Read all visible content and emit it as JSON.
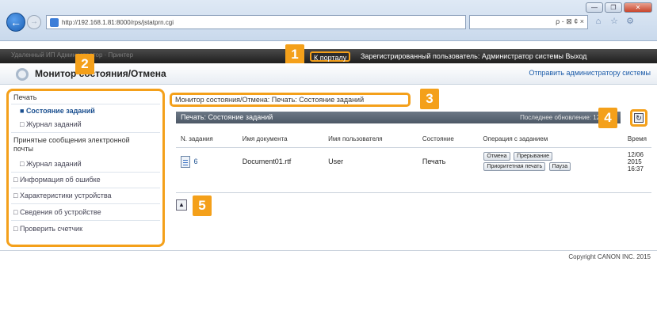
{
  "browser": {
    "address_url": "http://192.168.1.81:8000/rps/jstatprn.cgi",
    "search_text": "ρ - ⊠ ¢ ×",
    "window_buttons": [
      "—",
      "❐",
      "✕"
    ],
    "icons": [
      "home-icon",
      "star-icon",
      "gear-icon"
    ]
  },
  "topbar": {
    "left_text": "Удаленный ИП Администратор · Принтер",
    "portal_link": "К порталу",
    "user_text": "Зарегистрированный пользователь: Администратор системы Выход"
  },
  "header": {
    "title": "Монитор состояния/Отмена",
    "admin_link": "Отправить администратору системы"
  },
  "sidebar": {
    "items": [
      {
        "label": "Печать",
        "type": "section"
      },
      {
        "label": "Состояние заданий",
        "type": "active"
      },
      {
        "label": "Журнал заданий",
        "type": "sub"
      },
      {
        "label": "Принятые сообщения электронной",
        "type": "section"
      },
      {
        "label": "почты",
        "type": "section-cont"
      },
      {
        "label": "Журнал заданий",
        "type": "sub"
      },
      {
        "label": "Информация об ошибке",
        "type": "link"
      },
      {
        "label": "Характеристики устройства",
        "type": "link"
      },
      {
        "label": "Сведения об устройстве",
        "type": "link"
      },
      {
        "label": "Проверить счетчик",
        "type": "link"
      }
    ]
  },
  "breadcrumb": "Монитор состояния/Отмена: Печать: Состояние заданий",
  "panel": {
    "title": "Печать: Состояние заданий",
    "last_updated": "Последнее обновление: 12/06 2"
  },
  "table": {
    "headers": [
      "N. задания",
      "Имя документа",
      "Имя пользователя",
      "Состояние",
      "Операция с заданием",
      "Время"
    ],
    "rows": [
      {
        "job_number": "6",
        "document": "Document01.rtf",
        "user": "User",
        "status": "Печать",
        "time": "12/06 2015 16:37",
        "ops": [
          "Отмена",
          "Прерывание",
          "Приоритетная печать",
          "Пауза"
        ]
      }
    ]
  },
  "callouts": [
    "1",
    "2",
    "3",
    "4",
    "5"
  ],
  "footer": {
    "copyright": "Copyright CANON INC. 2015"
  },
  "colors": {
    "callout": "#f4a01a",
    "panel_header": "#5a6573",
    "topbar": "#2a2a2a"
  }
}
